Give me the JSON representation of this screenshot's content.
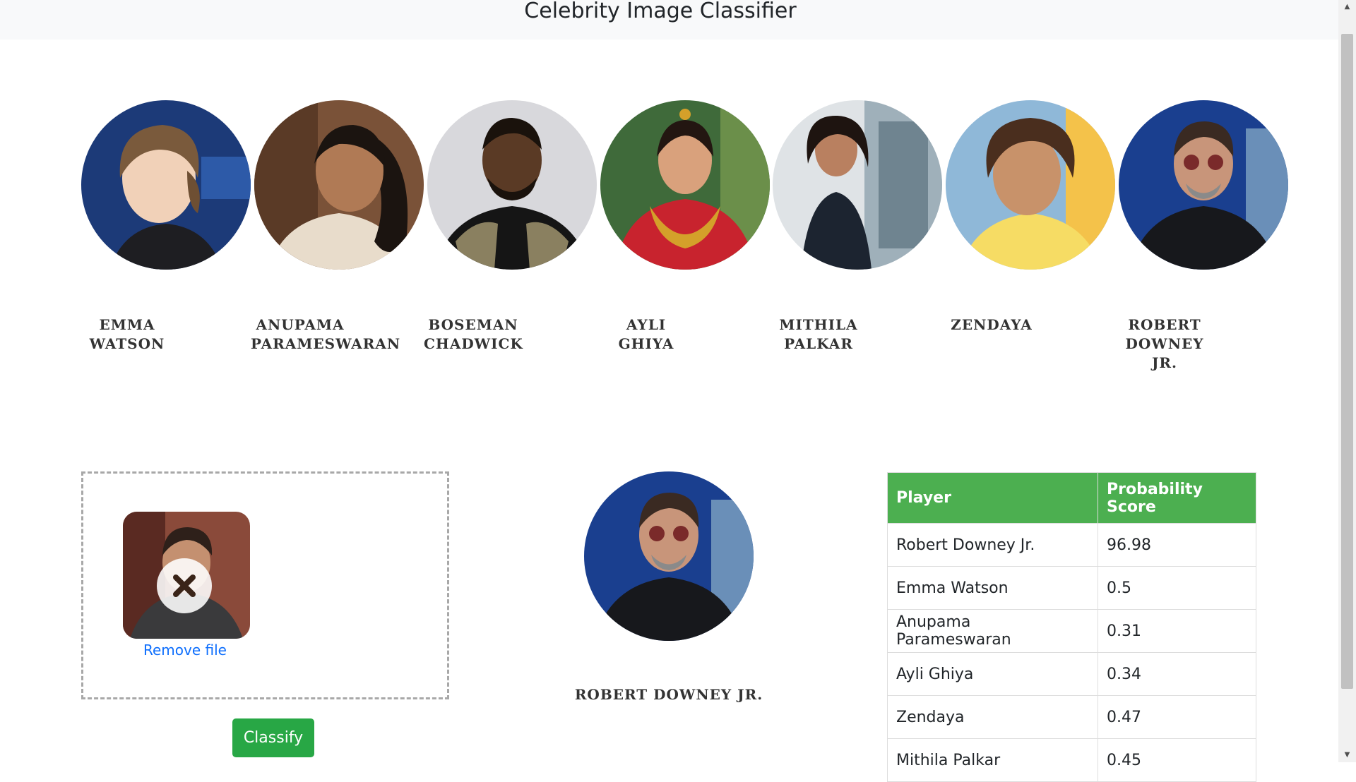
{
  "header": {
    "title": "Celebrity Image Classifier"
  },
  "celebrities": [
    {
      "name": "EMMA WATSON"
    },
    {
      "name": "ANUPAMA PARAMESWARAN"
    },
    {
      "name": "BOSEMAN CHADWICK"
    },
    {
      "name": "AYLI GHIYA"
    },
    {
      "name": "MITHILA PALKAR"
    },
    {
      "name": "ZENDAYA"
    },
    {
      "name": "ROBERT DOWNEY JR."
    }
  ],
  "upload": {
    "remove_label": "Remove file",
    "classify_label": "Classify"
  },
  "result": {
    "name": "ROBERT DOWNEY JR."
  },
  "table": {
    "headers": [
      "Player",
      "Probability Score"
    ],
    "rows": [
      [
        "Robert Downey Jr.",
        "96.98"
      ],
      [
        "Emma Watson",
        "0.5"
      ],
      [
        "Anupama Parameswaran",
        "0.31"
      ],
      [
        "Ayli Ghiya",
        "0.34"
      ],
      [
        "Zendaya",
        "0.47"
      ],
      [
        "Mithila Palkar",
        "0.45"
      ]
    ]
  },
  "colors": {
    "header_bg": "#f8f9fa",
    "table_header": "#4caf50",
    "button": "#28a745",
    "link": "#0d6efd"
  }
}
